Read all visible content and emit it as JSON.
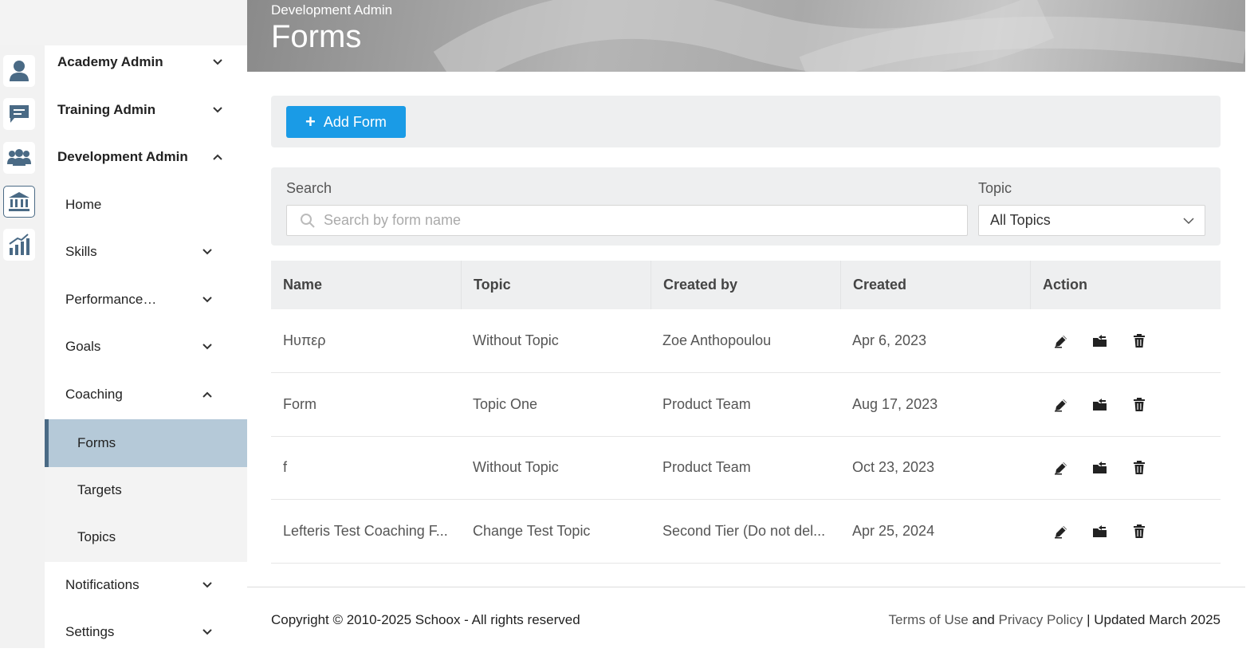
{
  "header": {
    "subtitle": "Development Admin",
    "title": "Forms"
  },
  "rail": {
    "icons": [
      "user-icon",
      "chat-icon",
      "team-icon",
      "institution-icon",
      "analytics-icon"
    ],
    "active": "institution-icon",
    "accent": "#4a6a85"
  },
  "sidebar": {
    "academy_admin": "Academy Admin",
    "training_admin": "Training Admin",
    "development_admin": "Development Admin",
    "home": "Home",
    "skills": "Skills",
    "performance": "Performance…",
    "goals": "Goals",
    "coaching": "Coaching",
    "forms": "Forms",
    "targets": "Targets",
    "topics": "Topics",
    "notifications": "Notifications",
    "settings": "Settings"
  },
  "toolbar": {
    "add_form_label": "Add Form",
    "add_button_color": "#1a9be6"
  },
  "filters": {
    "search_label": "Search",
    "search_placeholder": "Search by form name",
    "search_value": "",
    "topic_label": "Topic",
    "topic_selected": "All Topics"
  },
  "table": {
    "columns": [
      "Name",
      "Topic",
      "Created by",
      "Created",
      "Action"
    ],
    "rows": [
      {
        "name": "Ηυπερ",
        "topic": "Without Topic",
        "created_by": "Zoe Anthopoulou",
        "created": "Apr 6, 2023"
      },
      {
        "name": "Form",
        "topic": "Topic One",
        "created_by": "Product Team",
        "created": "Aug 17, 2023"
      },
      {
        "name": "f",
        "topic": "Without Topic",
        "created_by": "Product Team",
        "created": "Oct 23, 2023"
      },
      {
        "name": "Lefteris Test Coaching F...",
        "topic": "Change Test Topic",
        "created_by": "Second Tier (Do not del...",
        "created": "Apr 25, 2024"
      }
    ],
    "actions": [
      "edit-icon",
      "move-icon",
      "delete-icon"
    ]
  },
  "footer": {
    "copyright": "Copyright © 2010-2025 Schoox - All rights reserved",
    "terms": "Terms of Use",
    "and": "and",
    "privacy": "Privacy Policy",
    "updated": "| Updated March 2025"
  }
}
